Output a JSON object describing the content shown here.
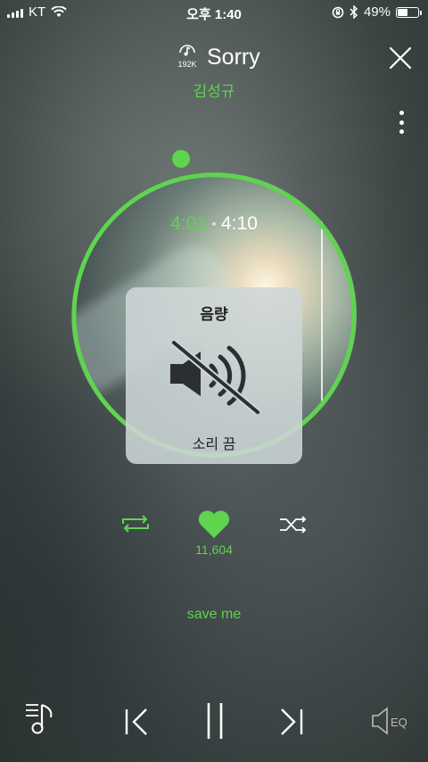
{
  "status_bar": {
    "carrier": "KT",
    "time": "오후 1:40",
    "battery_percent": "49%",
    "battery_level": 0.49
  },
  "header": {
    "quality_label": "192K",
    "song_title": "Sorry",
    "artist": "김성규"
  },
  "player": {
    "current_time": "4:01",
    "total_time": "4:10",
    "progress": 0.964
  },
  "volume_hud": {
    "title": "음량",
    "state": "소리 끔"
  },
  "actions": {
    "like_count": "11,604"
  },
  "lyric_line": "save me",
  "colors": {
    "accent": "#5fd44f"
  },
  "icons": [
    "wifi-icon",
    "lock-rotation-icon",
    "bluetooth-icon",
    "battery-icon",
    "hi-res-quality-icon",
    "close-icon",
    "more-options-icon",
    "speaker-muted-icon",
    "repeat-icon",
    "heart-icon",
    "shuffle-icon",
    "playlist-icon",
    "previous-icon",
    "pause-icon",
    "next-icon",
    "eq-icon"
  ]
}
